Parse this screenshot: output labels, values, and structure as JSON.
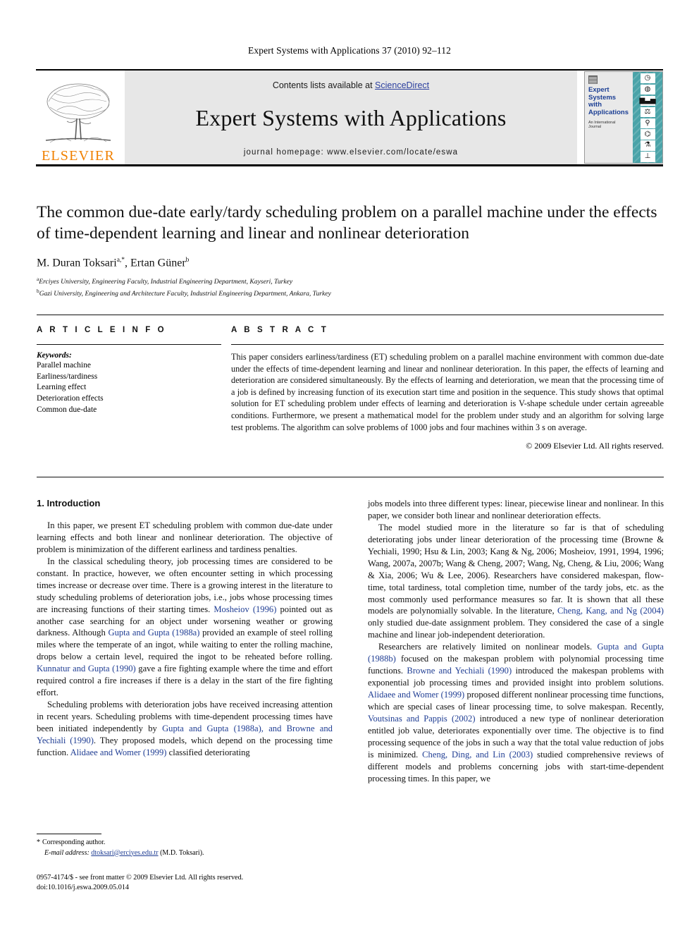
{
  "running_head": "Expert Systems with Applications 37 (2010) 92–112",
  "masthead": {
    "publisher_name": "ELSEVIER",
    "contents_prefix": "Contents lists available at ",
    "contents_link": "ScienceDirect",
    "journal_title": "Expert Systems with Applications",
    "homepage_line": "journal homepage: www.elsevier.com/locate/eswa",
    "cover": {
      "title_lines": [
        "Expert",
        "Systems",
        "with",
        "Applications"
      ],
      "subtitle_lines": [
        "An International",
        "Journal"
      ],
      "icon_names": [
        "clock-icon",
        "globe-icon",
        "bar-chart-icon",
        "scales-icon",
        "microscope-icon",
        "satellite-dish-icon",
        "flask-icon",
        "anvil-icon"
      ],
      "accent_color": "#4aa3a8"
    },
    "link_color": "#2b3f9e",
    "brand_color": "#f08000"
  },
  "article": {
    "title": "The common due-date early/tardy scheduling problem on a parallel machine under the effects of time-dependent learning and linear and nonlinear deterioration",
    "authors_plain": "M. Duran Toksari",
    "author_1": "M. Duran Toksari",
    "author_1_sup": "a,*",
    "author_2": "Ertan Güner",
    "author_2_sup": "b",
    "affiliation_a_sup": "a",
    "affiliation_a": "Erciyes University, Engineering Faculty, Industrial Engineering Department, Kayseri, Turkey",
    "affiliation_b_sup": "b",
    "affiliation_b": "Gazi University, Engineering and Architecture Faculty, Industrial Engineering Department, Ankara, Turkey"
  },
  "article_info": {
    "heading": "A R T I C L E   I N F O",
    "keywords_label": "Keywords:",
    "keywords": [
      "Parallel machine",
      "Earliness/tardiness",
      "Learning effect",
      "Deterioration effects",
      "Common due-date"
    ]
  },
  "abstract": {
    "heading": "A B S T R A C T",
    "text": "This paper considers earliness/tardiness (ET) scheduling problem on a parallel machine environment with common due-date under the effects of time-dependent learning and linear and nonlinear deterioration. In this paper, the effects of learning and deterioration are considered simultaneously. By the effects of learning and deterioration, we mean that the processing time of a job is defined by increasing function of its execution start time and position in the sequence. This study shows that optimal solution for ET scheduling problem under effects of learning and deterioration is V-shape schedule under certain agreeable conditions. Furthermore, we present a mathematical model for the problem under study and an algorithm for solving large test problems. The algorithm can solve problems of 1000 jobs and four machines within 3 s on average.",
    "copyright": "© 2009 Elsevier Ltd. All rights reserved."
  },
  "body": {
    "section_heading": "1. Introduction",
    "left_paragraphs": [
      "In this paper, we present ET scheduling problem with common due-date under learning effects and both linear and nonlinear deterioration. The objective of problem is minimization of the different earliness and tardiness penalties.",
      "In the classical scheduling theory, job processing times are considered to be constant. In practice, however, we often encounter setting in which processing times increase or decrease over time. There is a growing interest in the literature to study scheduling problems of deterioration jobs, i.e., jobs whose processing times are increasing functions of their starting times. Mosheiov (1996) pointed out as another case searching for an object under worsening weather or growing darkness. Although Gupta and Gupta (1988a) provided an example of steel rolling miles where the temperate of an ingot, while waiting to enter the rolling machine, drops below a certain level, required the ingot to be reheated before rolling. Kunnatur and Gupta (1990) gave a fire fighting example where the time and effort required control a fire increases if there is a delay in the start of the fire fighting effort.",
      "Scheduling problems with deterioration jobs have received increasing attention in recent years. Scheduling problems with time-dependent processing times have been initiated independently by Gupta and Gupta (1988a), and Browne and Yechiali (1990). They proposed models, which depend on the processing time function. Alidaee and Womer (1999) classified deteriorating"
    ],
    "right_paragraphs": [
      "jobs models into three different types: linear, piecewise linear and nonlinear. In this paper, we consider both linear and nonlinear deterioration effects.",
      "The model studied more in the literature so far is that of scheduling deteriorating jobs under linear deterioration of the processing time (Browne & Yechiali, 1990; Hsu & Lin, 2003; Kang & Ng, 2006; Mosheiov, 1991, 1994, 1996; Wang, 2007a, 2007b; Wang & Cheng, 2007; Wang, Ng, Cheng, & Liu, 2006; Wang & Xia, 2006; Wu & Lee, 2006). Researchers have considered makespan, flow-time, total tardiness, total completion time, number of the tardy jobs, etc. as the most commonly used performance measures so far. It is shown that all these models are polynomially solvable. In the literature, Cheng, Kang, and Ng (2004) only studied due-date assignment problem. They considered the case of a single machine and linear job-independent deterioration.",
      "Researchers are relatively limited on nonlinear models. Gupta and Gupta (1988b) focused on the makespan problem with polynomial processing time functions. Browne and Yechiali (1990) introduced the makespan problems with exponential job processing times and provided insight into problem solutions. Alidaee and Womer (1999) proposed different nonlinear processing time functions, which are special cases of linear processing time, to solve makespan. Recently, Voutsinas and Pappis (2002) introduced a new type of nonlinear deterioration entitled job value, deteriorates exponentially over time. The objective is to find processing sequence of the jobs in such a way that the total value reduction of jobs is minimized. Cheng, Ding, and Lin (2003) studied comprehensive reviews of different models and problems concerning jobs with start-time-dependent processing times. In this paper, we"
    ]
  },
  "footnote": {
    "marker": "*",
    "corresponding": "Corresponding author.",
    "email_label": "E-mail address:",
    "email": "dtoksari@erciyes.edu.tr",
    "email_owner": "(M.D. Toksari)."
  },
  "page_footer": {
    "line1": "0957-4174/$ - see front matter © 2009 Elsevier Ltd. All rights reserved.",
    "line2": "doi:10.1016/j.eswa.2009.05.014"
  }
}
